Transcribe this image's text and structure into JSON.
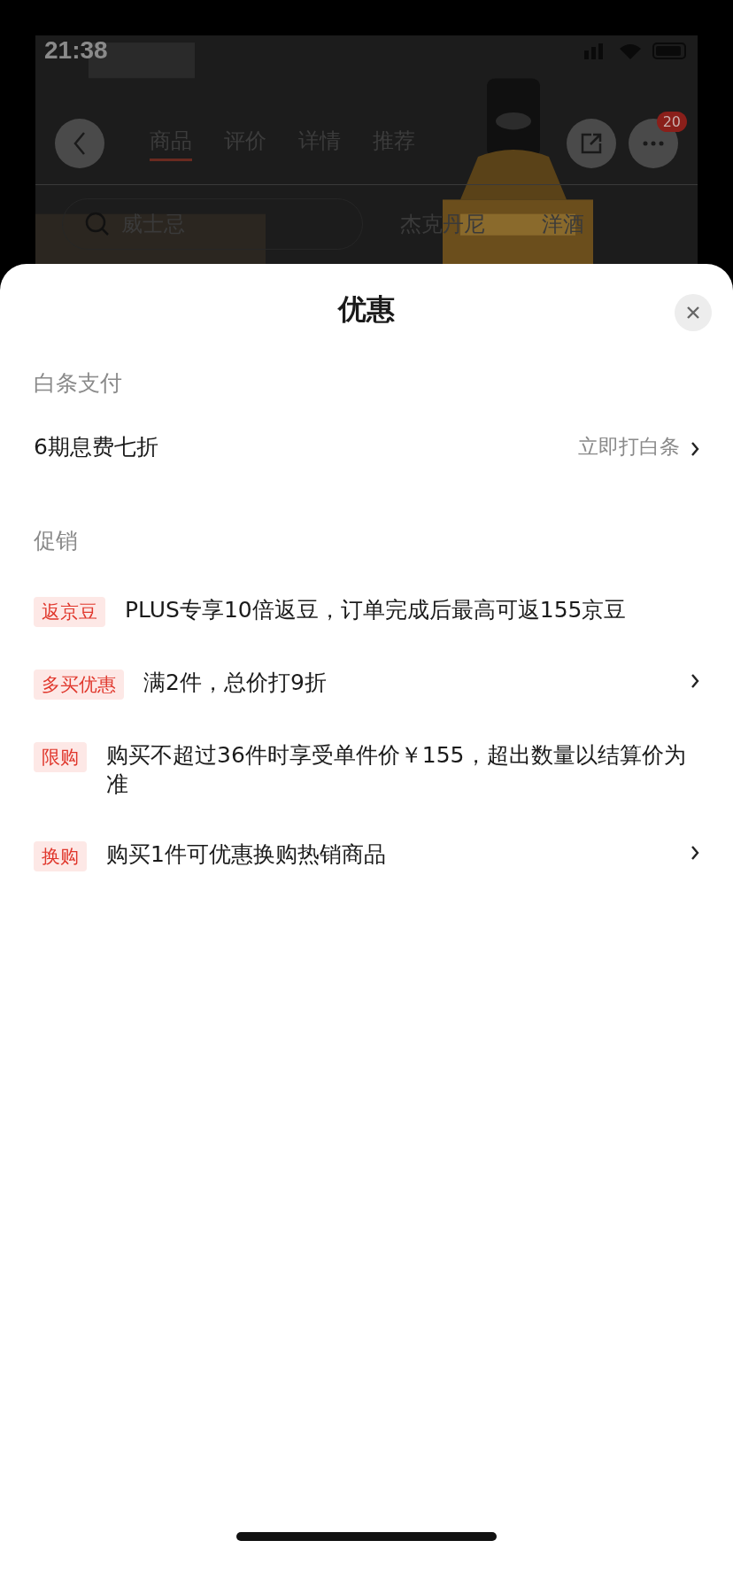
{
  "status_bar": {
    "time": "21:38"
  },
  "background_page": {
    "tabs": [
      {
        "label": "商品",
        "selected": true
      },
      {
        "label": "评价",
        "selected": false
      },
      {
        "label": "详情",
        "selected": false
      },
      {
        "label": "推荐",
        "selected": false
      }
    ],
    "message_badge": "20",
    "search": {
      "value": "威士忌"
    },
    "search_chips": [
      "杰克丹尼",
      "洋酒"
    ]
  },
  "sheet": {
    "title": "优惠",
    "sections": [
      {
        "heading": "白条支付",
        "rows": [
          {
            "kind": "plain",
            "text": "6期息费七折",
            "action": "立即打白条",
            "chevron": true
          }
        ]
      },
      {
        "heading": "促销",
        "rows": [
          {
            "kind": "tagged",
            "tag": "返京豆",
            "text": "PLUS专享10倍返豆，订单完成后最高可返155京豆",
            "chevron": false
          },
          {
            "kind": "tagged",
            "tag": "多买优惠",
            "text": "满2件，总价打9折",
            "chevron": true
          },
          {
            "kind": "tagged",
            "tag": "限购",
            "text": "购买不超过36件时享受单件价￥155，超出数量以结算价为准",
            "chevron": false
          },
          {
            "kind": "tagged",
            "tag": "换购",
            "text": "购买1件可优惠换购热销商品",
            "chevron": true
          }
        ]
      }
    ]
  }
}
